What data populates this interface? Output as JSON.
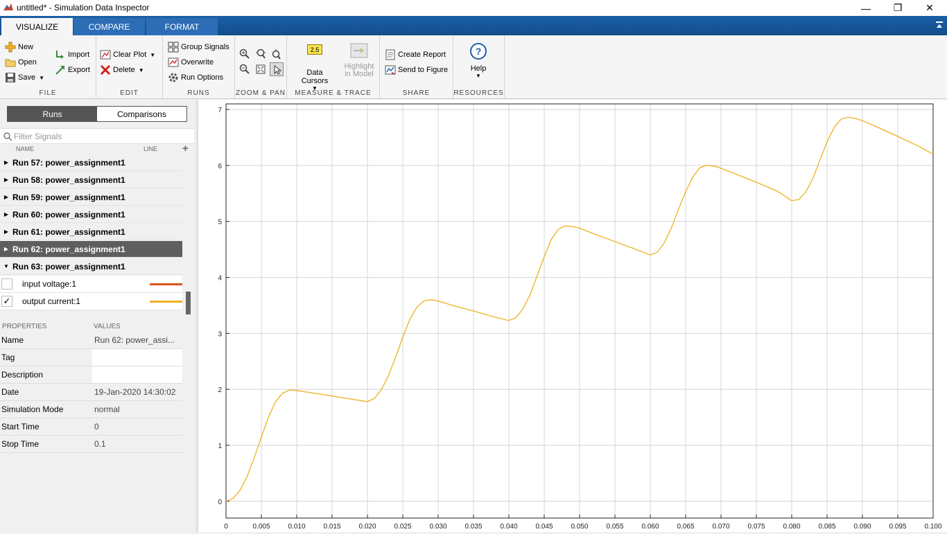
{
  "window": {
    "title": "untitled* - Simulation Data Inspector",
    "minimize": "—",
    "restore": "❐",
    "close": "✕"
  },
  "ribbon_tabs": [
    "VISUALIZE",
    "COMPARE",
    "FORMAT"
  ],
  "ribbon": {
    "file": {
      "label": "FILE",
      "new": "New",
      "open": "Open",
      "save": "Save",
      "import": "Import",
      "export": "Export"
    },
    "edit": {
      "label": "EDIT",
      "clear_plot": "Clear Plot",
      "delete": "Delete"
    },
    "runs": {
      "label": "RUNS",
      "group_signals": "Group Signals",
      "overwrite": "Overwrite",
      "run_options": "Run Options"
    },
    "zoom": {
      "label": "ZOOM & PAN"
    },
    "measure": {
      "label": "MEASURE & TRACE",
      "data_cursors": "Data Cursors",
      "cursor_badge": "2.5",
      "highlight_line1": "Highlight",
      "highlight_line2": "in Model"
    },
    "share": {
      "label": "SHARE",
      "create_report": "Create Report",
      "send_to_figure": "Send to Figure"
    },
    "resources": {
      "label": "RESOURCES",
      "help": "Help"
    }
  },
  "left_panel": {
    "seg_runs": "Runs",
    "seg_comparisons": "Comparisons",
    "filter_placeholder": "Filter Signals",
    "col_name": "NAME",
    "col_line": "LINE",
    "runs": [
      "Run 57: power_assignment1",
      "Run 58: power_assignment1",
      "Run 59: power_assignment1",
      "Run 60: power_assignment1",
      "Run 61: power_assignment1",
      "Run 62: power_assignment1",
      "Run 63: power_assignment1"
    ],
    "selected_run_index": 5,
    "signals": [
      {
        "name": "input voltage:1",
        "checked": false,
        "color": "#d95319"
      },
      {
        "name": "output current:1",
        "checked": true,
        "color": "#edb120"
      }
    ],
    "props_header": "PROPERTIES",
    "values_header": "VALUES",
    "properties": [
      {
        "key": "Name",
        "value": "Run 62: power_assi..."
      },
      {
        "key": "Tag",
        "value": ""
      },
      {
        "key": "Description",
        "value": ""
      },
      {
        "key": "Date",
        "value": "19-Jan-2020 14:30:02"
      },
      {
        "key": "Simulation Mode",
        "value": "normal"
      },
      {
        "key": "Start Time",
        "value": "0"
      },
      {
        "key": "Stop Time",
        "value": "0.1"
      }
    ]
  },
  "chart_data": {
    "type": "line",
    "title": "",
    "xlabel": "",
    "ylabel": "",
    "xlim": [
      0,
      0.1
    ],
    "ylim": [
      -0.3,
      7.1
    ],
    "x_ticks": [
      "0",
      "0.005",
      "0.010",
      "0.015",
      "0.020",
      "0.025",
      "0.030",
      "0.035",
      "0.040",
      "0.045",
      "0.050",
      "0.055",
      "0.060",
      "0.065",
      "0.070",
      "0.075",
      "0.080",
      "0.085",
      "0.090",
      "0.095",
      "0.100"
    ],
    "y_ticks": [
      "0",
      "1",
      "2",
      "3",
      "4",
      "5",
      "6",
      "7"
    ],
    "grid": true,
    "series": [
      {
        "color": "#edb120",
        "x": [
          0,
          0.001,
          0.002,
          0.003,
          0.004,
          0.005,
          0.006,
          0.007,
          0.008,
          0.009,
          0.01,
          0.012,
          0.015,
          0.018,
          0.02,
          0.021,
          0.022,
          0.023,
          0.024,
          0.025,
          0.026,
          0.027,
          0.028,
          0.029,
          0.03,
          0.032,
          0.035,
          0.038,
          0.04,
          0.041,
          0.042,
          0.043,
          0.044,
          0.045,
          0.046,
          0.047,
          0.048,
          0.049,
          0.05,
          0.052,
          0.055,
          0.058,
          0.06,
          0.061,
          0.062,
          0.063,
          0.064,
          0.065,
          0.066,
          0.067,
          0.068,
          0.069,
          0.07,
          0.072,
          0.075,
          0.078,
          0.08,
          0.081,
          0.082,
          0.083,
          0.084,
          0.085,
          0.086,
          0.087,
          0.088,
          0.089,
          0.09,
          0.092,
          0.095,
          0.098,
          0.1
        ],
        "y": [
          0,
          0.05,
          0.2,
          0.45,
          0.78,
          1.15,
          1.5,
          1.78,
          1.93,
          1.99,
          1.98,
          1.94,
          1.88,
          1.82,
          1.78,
          1.84,
          2.0,
          2.25,
          2.58,
          2.93,
          3.25,
          3.47,
          3.58,
          3.6,
          3.58,
          3.5,
          3.4,
          3.29,
          3.23,
          3.28,
          3.44,
          3.69,
          4.03,
          4.37,
          4.68,
          4.86,
          4.92,
          4.91,
          4.88,
          4.78,
          4.64,
          4.5,
          4.4,
          4.45,
          4.62,
          4.89,
          5.22,
          5.53,
          5.79,
          5.96,
          6.0,
          5.99,
          5.95,
          5.85,
          5.7,
          5.54,
          5.37,
          5.39,
          5.53,
          5.77,
          6.1,
          6.42,
          6.68,
          6.83,
          6.86,
          6.84,
          6.8,
          6.69,
          6.52,
          6.34,
          6.2
        ]
      }
    ]
  }
}
